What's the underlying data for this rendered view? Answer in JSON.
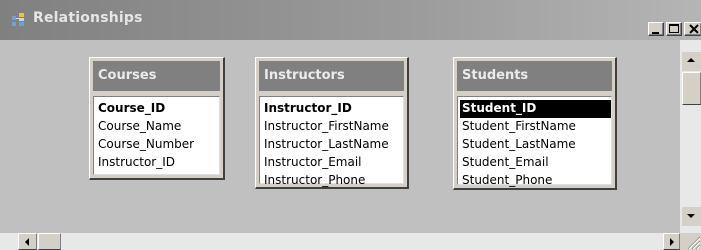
{
  "window": {
    "title": "Relationships",
    "icon": "relationships-icon",
    "controls": {
      "minimize": "minimize-icon",
      "maximize": "maximize-icon",
      "close": "close-icon"
    }
  },
  "tables": [
    {
      "name": "Courses",
      "fields": [
        {
          "label": "Course_ID",
          "primary_key": true,
          "selected": false
        },
        {
          "label": "Course_Name",
          "primary_key": false,
          "selected": false
        },
        {
          "label": "Course_Number",
          "primary_key": false,
          "selected": false
        },
        {
          "label": "Instructor_ID",
          "primary_key": false,
          "selected": false
        }
      ]
    },
    {
      "name": "Instructors",
      "fields": [
        {
          "label": "Instructor_ID",
          "primary_key": true,
          "selected": false
        },
        {
          "label": "Instructor_FirstName",
          "primary_key": false,
          "selected": false
        },
        {
          "label": "Instructor_LastName",
          "primary_key": false,
          "selected": false
        },
        {
          "label": "Instructor_Email",
          "primary_key": false,
          "selected": false
        },
        {
          "label": "Instructor_Phone",
          "primary_key": false,
          "selected": false
        }
      ]
    },
    {
      "name": "Students",
      "fields": [
        {
          "label": "Student_ID",
          "primary_key": true,
          "selected": true
        },
        {
          "label": "Student_FirstName",
          "primary_key": false,
          "selected": false
        },
        {
          "label": "Student_LastName",
          "primary_key": false,
          "selected": false
        },
        {
          "label": "Student_Email",
          "primary_key": false,
          "selected": false
        },
        {
          "label": "Student_Phone",
          "primary_key": false,
          "selected": false
        }
      ]
    }
  ],
  "colors": {
    "title_bar": "#808080",
    "canvas": "#c0c0c0",
    "table_header": "#808080",
    "selection": "#000000"
  }
}
